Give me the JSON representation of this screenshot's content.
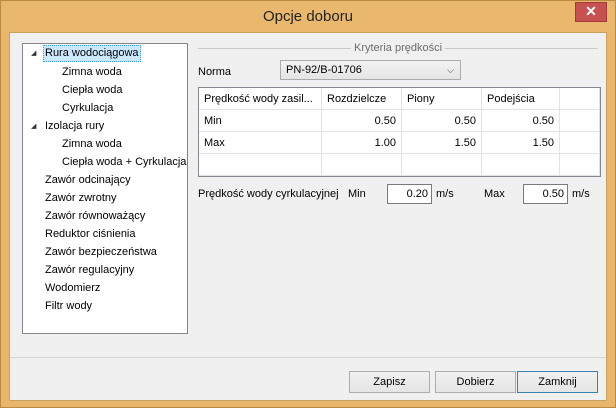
{
  "window": {
    "title": "Opcje doboru",
    "close_glyph": "✕"
  },
  "tree": {
    "items": [
      {
        "label": "Rura wodociągowa",
        "level": 0,
        "expanded": true,
        "selected": true
      },
      {
        "label": "Zimna woda",
        "level": 1
      },
      {
        "label": "Ciepła woda",
        "level": 1
      },
      {
        "label": "Cyrkulacja",
        "level": 1
      },
      {
        "label": "Izolacja rury",
        "level": 0,
        "expanded": true
      },
      {
        "label": "Zimna woda",
        "level": 1
      },
      {
        "label": "Ciepła woda + Cyrkulacja",
        "level": 1
      },
      {
        "label": "Zawór odcinający",
        "level": 0
      },
      {
        "label": "Zawór zwrotny",
        "level": 0
      },
      {
        "label": "Zawór równoważący",
        "level": 0
      },
      {
        "label": "Reduktor ciśnienia",
        "level": 0
      },
      {
        "label": "Zawór bezpieczeństwa",
        "level": 0
      },
      {
        "label": "Zawór regulacyjny",
        "level": 0
      },
      {
        "label": "Wodomierz",
        "level": 0
      },
      {
        "label": "Filtr wody",
        "level": 0
      }
    ]
  },
  "criteria": {
    "group_title": "Kryteria prędkości",
    "norma_label": "Norma",
    "norma_value": "PN-92/B-01706",
    "table": {
      "headers": [
        "Prędkość wody zasil...",
        "Rozdzielcze",
        "Piony",
        "Podejścia"
      ],
      "rows": [
        [
          "Min",
          "0.50",
          "0.50",
          "0.50"
        ],
        [
          "Max",
          "1.00",
          "1.50",
          "1.50"
        ]
      ]
    },
    "circulation": {
      "label": "Prędkość wody cyrkulacyjnej",
      "min_label": "Min",
      "min_value": "0.20",
      "max_label": "Max",
      "max_value": "0.50",
      "unit": "m/s"
    }
  },
  "buttons": {
    "save": "Zapisz",
    "select": "Dobierz",
    "close": "Zamknij"
  }
}
